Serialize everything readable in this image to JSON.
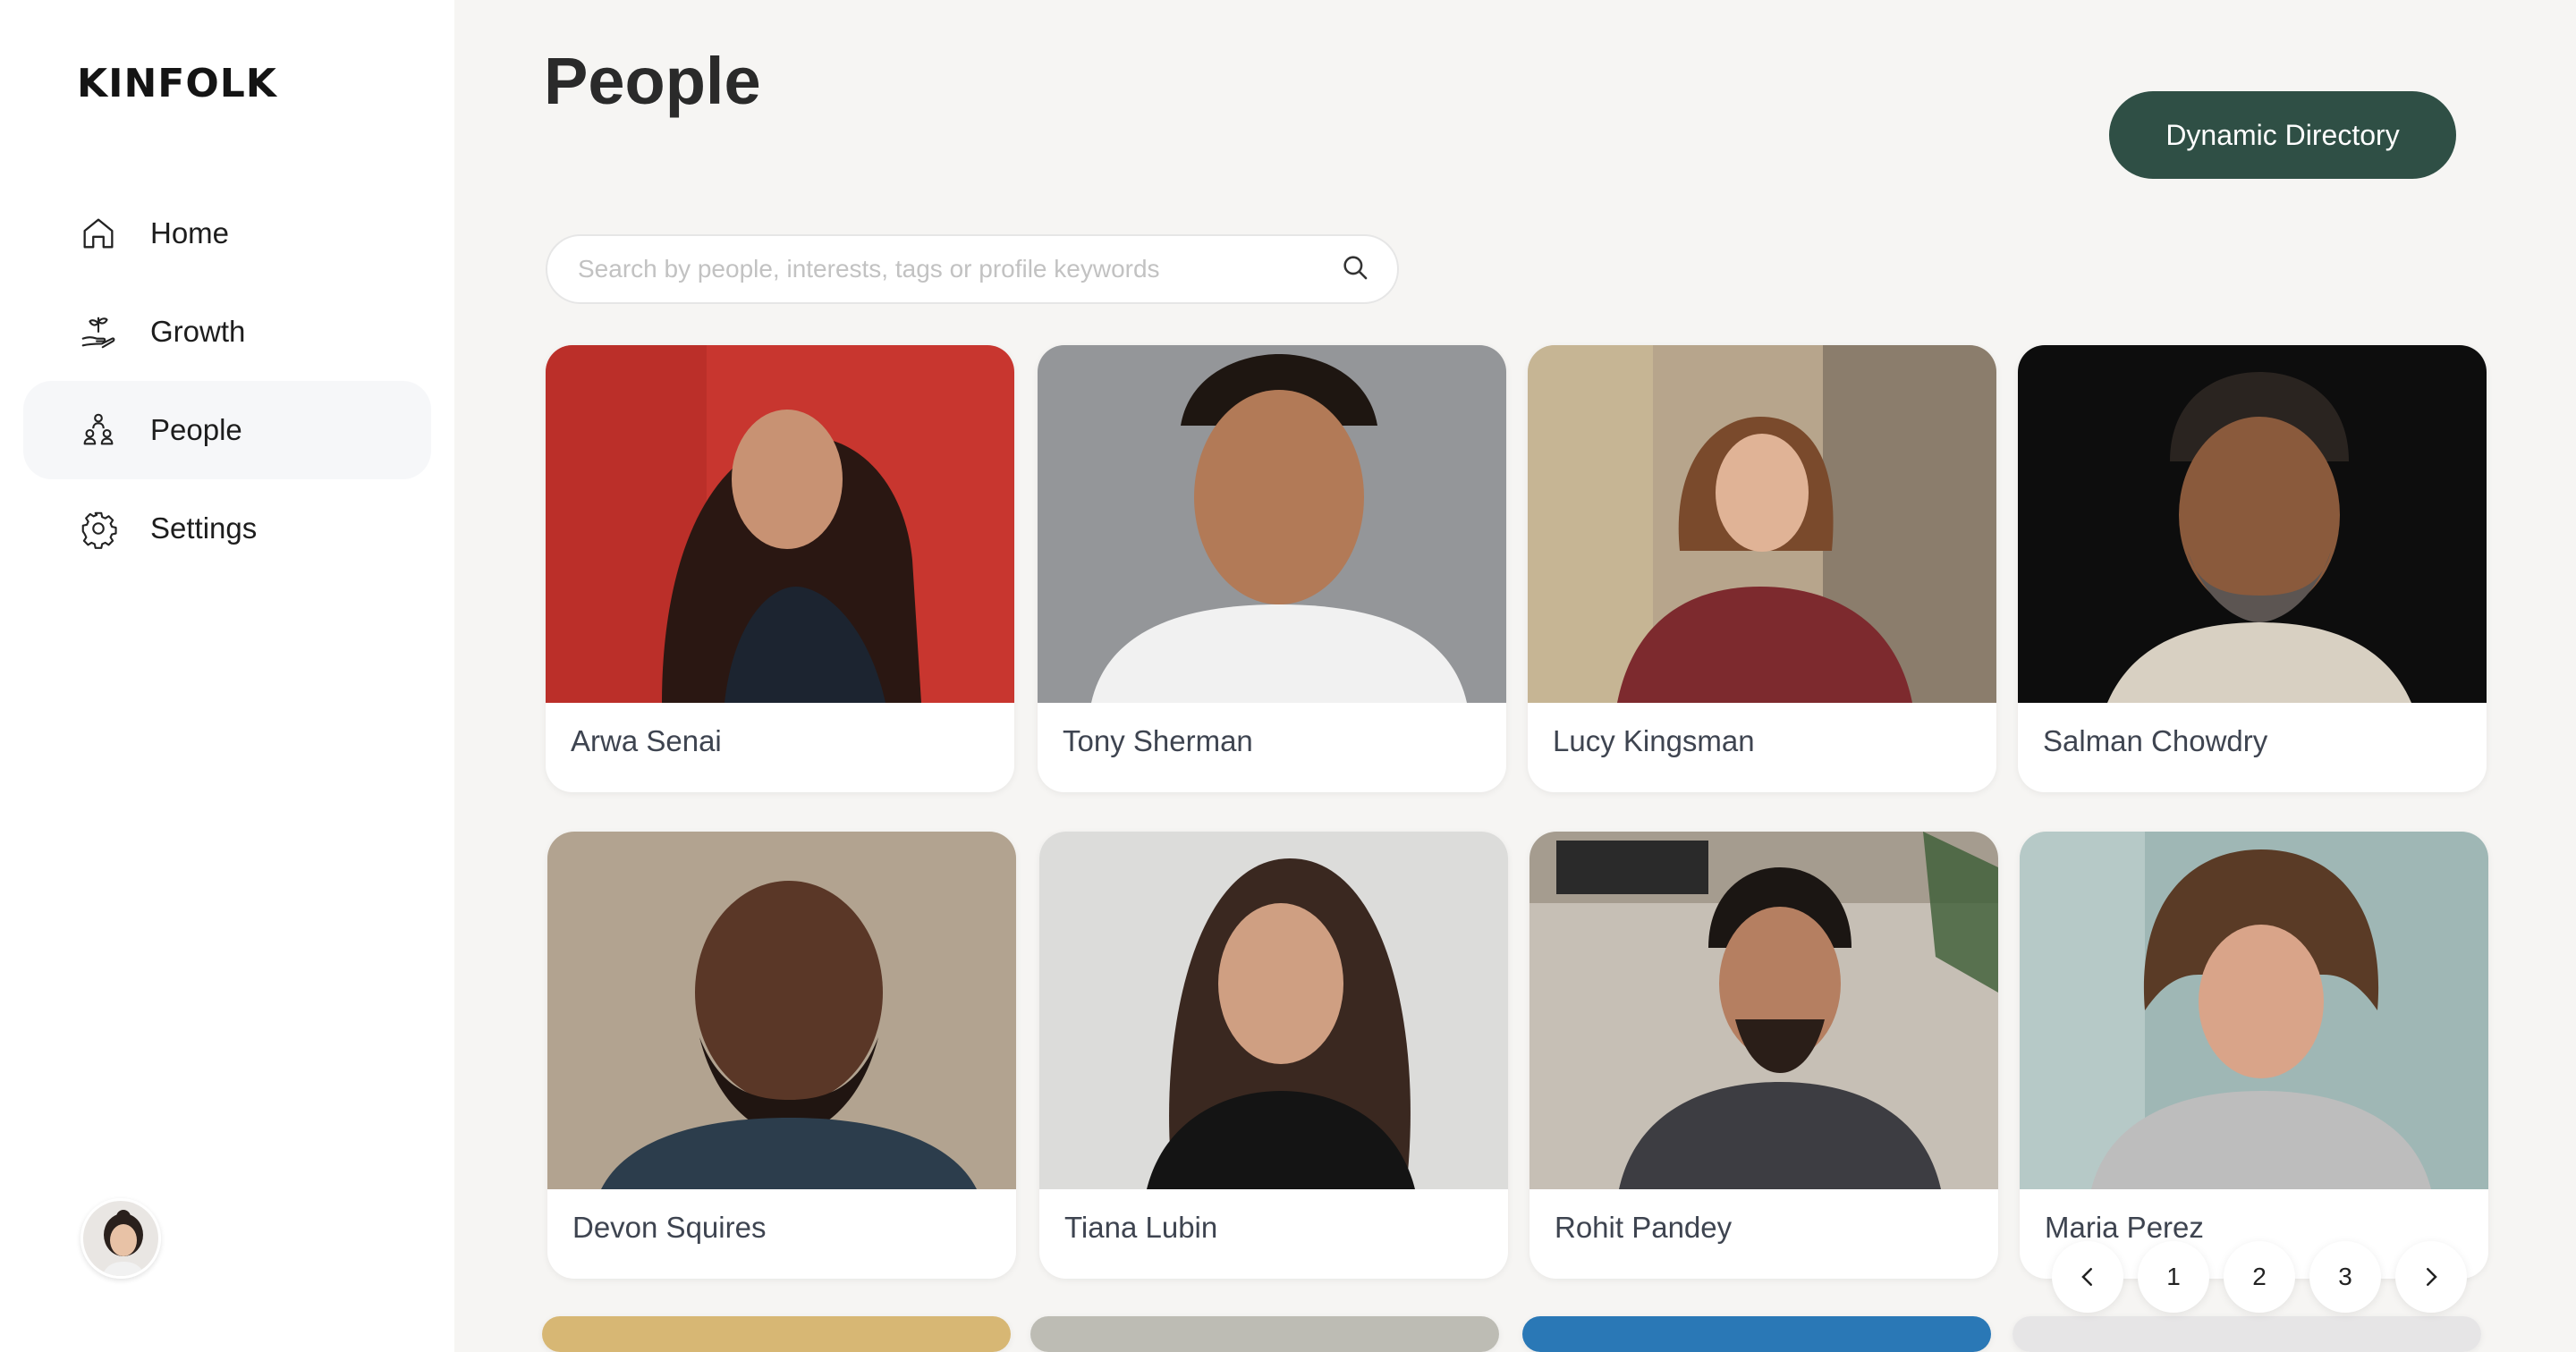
{
  "brand": {
    "logo_text": "KINFOLK"
  },
  "sidebar": {
    "items": [
      {
        "label": "Home",
        "icon": "home-icon",
        "active": false
      },
      {
        "label": "Growth",
        "icon": "growth-icon",
        "active": false
      },
      {
        "label": "People",
        "icon": "people-icon",
        "active": true
      },
      {
        "label": "Settings",
        "icon": "gear-icon",
        "active": false
      }
    ],
    "user_avatar": "avatar"
  },
  "header": {
    "title": "People",
    "primary_button": "Dynamic Directory"
  },
  "search": {
    "placeholder": "Search by people, interests, tags or profile keywords",
    "value": ""
  },
  "people": [
    {
      "name": "Arwa Senai",
      "bg": "#c8362f"
    },
    {
      "name": "Tony Sherman",
      "bg": "#9a9c9e"
    },
    {
      "name": "Lucy Kingsman",
      "bg": "#b7a58c"
    },
    {
      "name": "Salman Chowdry",
      "bg": "#0d0d0d"
    },
    {
      "name": "Devon Squires",
      "bg": "#b9ab98"
    },
    {
      "name": "Tiana Lubin",
      "bg": "#dcdcda"
    },
    {
      "name": "Rohit Pandey",
      "bg": "#a59c8f"
    },
    {
      "name": "Maria Perez",
      "bg": "#9fb7b5"
    }
  ],
  "next_row_colors": [
    "#d7b774",
    "#bdbcb4",
    "#2a78b6",
    "#e6e5e6"
  ],
  "pagination": {
    "prev_icon": "chevron-left-icon",
    "pages": [
      "1",
      "2",
      "3"
    ],
    "next_icon": "chevron-right-icon"
  },
  "colors": {
    "accent": "#2f4f45",
    "page_bg": "#f6f5f3",
    "sidebar_bg": "#ffffff",
    "active_nav_bg": "#f6f7f9"
  }
}
